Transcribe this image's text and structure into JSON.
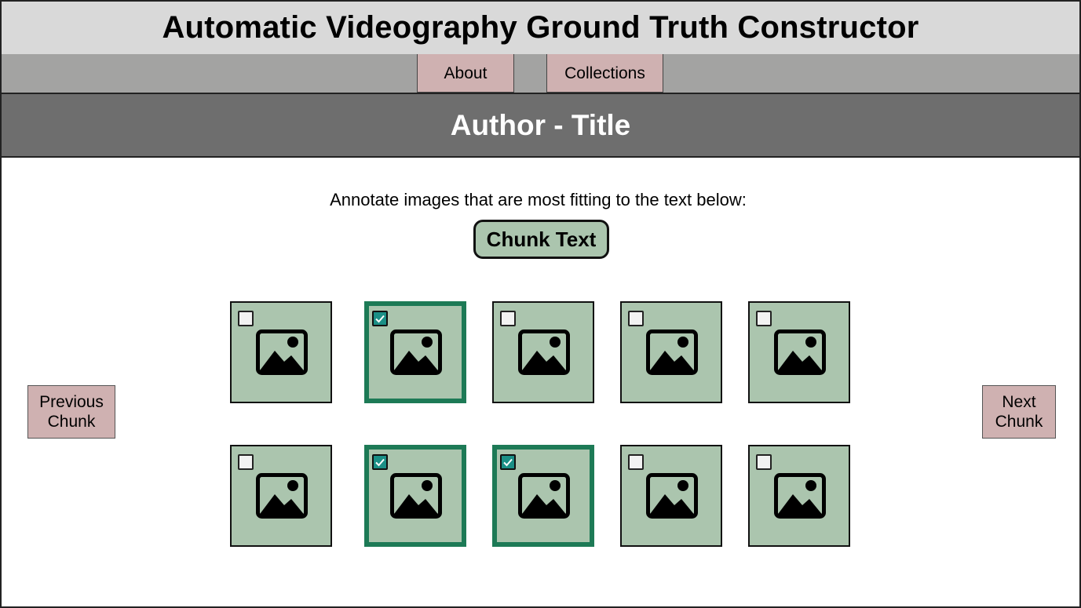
{
  "header": {
    "title": "Automatic Videography Ground Truth Constructor"
  },
  "nav": {
    "about_label": "About",
    "collections_label": "Collections"
  },
  "page": {
    "title": "Author - Title"
  },
  "annotation": {
    "instruction": "Annotate images that are most fitting to the text below:",
    "chunk_text": "Chunk Text"
  },
  "navigation": {
    "previous_label": "Previous\nChunk",
    "next_label": "Next\nChunk"
  },
  "images": {
    "row_1": [
      {
        "icon": "image-icon",
        "checked": false
      },
      {
        "icon": "image-icon",
        "checked": true
      },
      {
        "icon": "image-icon",
        "checked": false
      },
      {
        "icon": "image-icon",
        "checked": false
      },
      {
        "icon": "image-icon",
        "checked": false
      }
    ],
    "row_2": [
      {
        "icon": "image-icon",
        "checked": false
      },
      {
        "icon": "image-icon",
        "checked": true
      },
      {
        "icon": "image-icon",
        "checked": true
      },
      {
        "icon": "image-icon",
        "checked": false
      },
      {
        "icon": "image-icon",
        "checked": false
      }
    ]
  },
  "colors": {
    "header_bg": "#d9d9d9",
    "nav_bg": "#a3a3a2",
    "button_bg": "#cfb1b1",
    "title_bg": "#6e6e6e",
    "tile_bg": "#abc5ae",
    "selected_border": "#1d7a56",
    "checkbox_checked": "#1b8f86"
  }
}
